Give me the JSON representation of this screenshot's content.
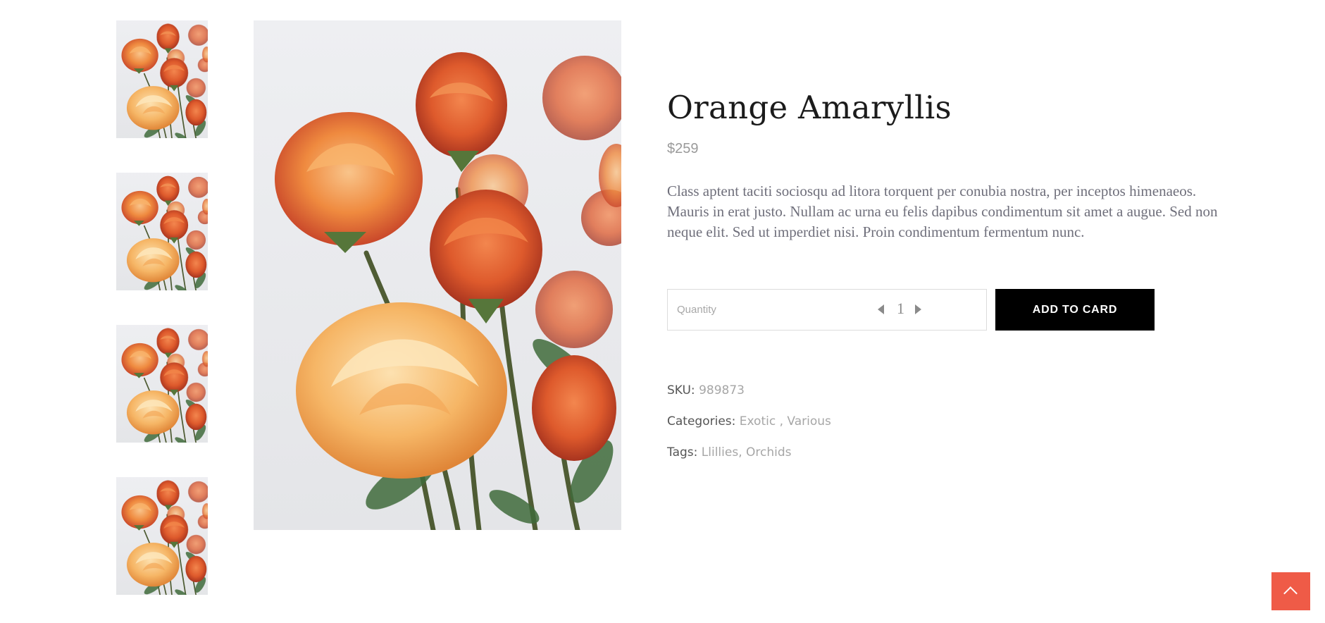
{
  "product": {
    "title": "Orange Amaryllis",
    "price": "$259",
    "description": "Class aptent taciti sociosqu ad litora torquent per conubia nostra, per inceptos himenaeos. Mauris in erat justo. Nullam ac urna eu felis dapibus condimentum sit amet a augue. Sed non neque elit. Sed ut imperdiet nisi. Proin condimentum fermentum nunc."
  },
  "cart": {
    "quantity_label": "Quantity",
    "quantity_value": "1",
    "add_button_label": "ADD TO CARD"
  },
  "meta": {
    "sku_label": "SKU:",
    "sku_value": "989873",
    "categories_label": "Categories:",
    "categories": [
      "Exotic",
      "Various"
    ],
    "tags_label": "Tags:",
    "tags": [
      "Llillies",
      "Orchids"
    ]
  },
  "gallery": {
    "thumbnail_count": 4,
    "image_subject": "orange-roses"
  },
  "icons": {
    "back_to_top": "chevron-up-icon",
    "qty_decrease": "caret-left-icon",
    "qty_increase": "caret-right-icon"
  },
  "colors": {
    "accent": "#ef5b47",
    "button_bg": "#000000",
    "title": "#1b1b1b",
    "muted": "#a6a6a6",
    "description": "#6f6f7b"
  }
}
